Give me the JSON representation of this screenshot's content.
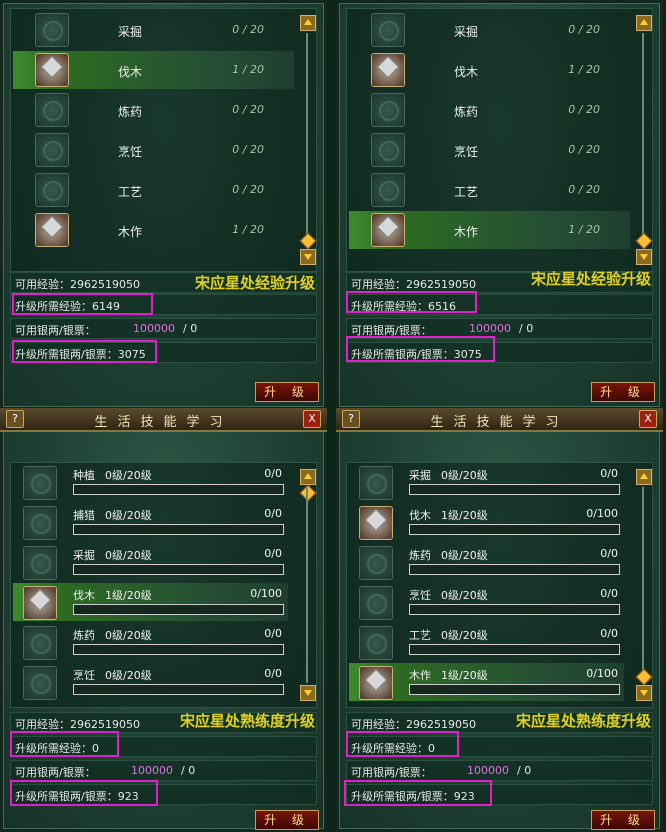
{
  "panels": [
    {
      "rows": [
        {
          "name": "采掘",
          "count": "0 / 20"
        },
        {
          "name": "伐木",
          "count": "1 / 20"
        },
        {
          "name": "炼药",
          "count": "0 / 20"
        },
        {
          "name": "烹饪",
          "count": "0 / 20"
        },
        {
          "name": "工艺",
          "count": "0 / 20"
        },
        {
          "name": "木作",
          "count": "1 / 20"
        }
      ],
      "exp_label": "可用经验：2962519050",
      "note": "宋应星处经验升级",
      "req_exp": "升级所需经验：6149",
      "silver_label": "可用银两/银票：",
      "silver_value": "100000",
      "silver_tail": "/ 0",
      "req_silver": "升级所需银两/银票：3075",
      "upgrade": "升 级"
    },
    {
      "rows": [
        {
          "name": "采掘",
          "count": "0 / 20"
        },
        {
          "name": "伐木",
          "count": "1 / 20"
        },
        {
          "name": "炼药",
          "count": "0 / 20"
        },
        {
          "name": "烹饪",
          "count": "0 / 20"
        },
        {
          "name": "工艺",
          "count": "0 / 20"
        },
        {
          "name": "木作",
          "count": "1 / 20"
        }
      ],
      "exp_label": "可用经验：2962519050",
      "note": "宋应星处经验升级",
      "req_exp": "升级所需经验：6516",
      "silver_label": "可用银两/银票：",
      "silver_value": "100000",
      "silver_tail": "/ 0",
      "req_silver": "升级所需银两/银票：3075",
      "upgrade": "升 级"
    },
    {
      "title": "生活技能学习",
      "help": "?",
      "close": "X",
      "rows": [
        {
          "name": "种植",
          "level": "0级/20级",
          "progress": "0/0"
        },
        {
          "name": "捕猎",
          "level": "0级/20级",
          "progress": "0/0"
        },
        {
          "name": "采掘",
          "level": "0级/20级",
          "progress": "0/0"
        },
        {
          "name": "伐木",
          "level": "1级/20级",
          "progress": "0/100"
        },
        {
          "name": "炼药",
          "level": "0级/20级",
          "progress": "0/0"
        },
        {
          "name": "烹饪",
          "level": "0级/20级",
          "progress": "0/0"
        }
      ],
      "exp_label": "可用经验：2962519050",
      "note": "宋应星处熟练度升级",
      "req_exp": "升级所需经验：0",
      "silver_label": "可用银两/银票：",
      "silver_value": "100000",
      "silver_tail": "/ 0",
      "req_silver": "升级所需银两/银票：923",
      "upgrade": "升 级"
    },
    {
      "title": "生活技能学习",
      "help": "?",
      "close": "X",
      "rows": [
        {
          "name": "采掘",
          "level": "0级/20级",
          "progress": "0/0"
        },
        {
          "name": "伐木",
          "level": "1级/20级",
          "progress": "0/100"
        },
        {
          "name": "炼药",
          "level": "0级/20级",
          "progress": "0/0"
        },
        {
          "name": "烹饪",
          "level": "0级/20级",
          "progress": "0/0"
        },
        {
          "name": "工艺",
          "level": "0级/20级",
          "progress": "0/0"
        },
        {
          "name": "木作",
          "level": "1级/20级",
          "progress": "0/100"
        }
      ],
      "exp_label": "可用经验：2962519050",
      "note": "宋应星处熟练度升级",
      "req_exp": "升级所需经验：0",
      "silver_label": "可用银两/银票：",
      "silver_value": "100000",
      "silver_tail": "/ 0",
      "req_silver": "升级所需银两/银票：923",
      "upgrade": "升 级"
    }
  ],
  "colors": {
    "highlight": "#e020d0",
    "note": "#e0d020",
    "money": "#e070e0",
    "selected": "#3e8a2e"
  }
}
